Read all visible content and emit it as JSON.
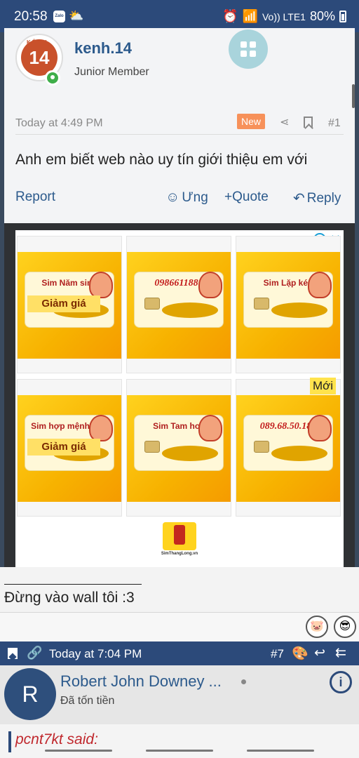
{
  "status_bar": {
    "time": "20:58",
    "zalo_label": "Zalo",
    "weather_icon": "cloud-sun-icon",
    "alarm_icon": "alarm-icon",
    "wifi_icon": "wifi-icon",
    "network_label": "Vo)) LTE1",
    "signal_icon": "signal-icon",
    "battery": "80%"
  },
  "post": {
    "avatar_top": "KÊNH",
    "avatar_text": "14",
    "username": "kenh.14",
    "user_title": "Junior Member",
    "timestamp": "Today at 4:49 PM",
    "badge": "New",
    "share_icon": "share-icon",
    "bookmark_icon": "bookmark-icon",
    "post_number": "#1",
    "message": "Anh em biết web nào uy tín giới thiệu em với",
    "actions": {
      "report": "Report",
      "react": "Ưng",
      "quote": "+Quote",
      "reply": "Reply"
    }
  },
  "ad": {
    "info_icon": "info-icon",
    "close_icon": "close-icon",
    "tiles": [
      {
        "title": "Sim Năm sinh",
        "sale": "Giảm giá"
      },
      {
        "title": "0986611881",
        "sale": ""
      },
      {
        "title": "Sim Lặp kép",
        "sale": ""
      },
      {
        "title": "Sim hợp mệnh Hỏa",
        "sale": "Giảm giá"
      },
      {
        "title": "Sim Tam hoa",
        "sale": ""
      },
      {
        "title": "089.68.50.186",
        "sale": ""
      }
    ],
    "new_label": "Mới",
    "logo_text": "SimThangLong.vn"
  },
  "signature": {
    "text": "Đừng vào wall tôi :3"
  },
  "next_post": {
    "timestamp": "Today at 7:04 PM",
    "post_number": "#7",
    "avatar_letter": "R",
    "username": "Robert John Downey ...",
    "user_title": "Đã tốn tiền",
    "quote_author": "pcnt7kt said:"
  },
  "colors": {
    "primary": "#2c4a7a",
    "link": "#2c5a8c",
    "badge": "#f7915a",
    "quote_author": "#c0282d"
  }
}
